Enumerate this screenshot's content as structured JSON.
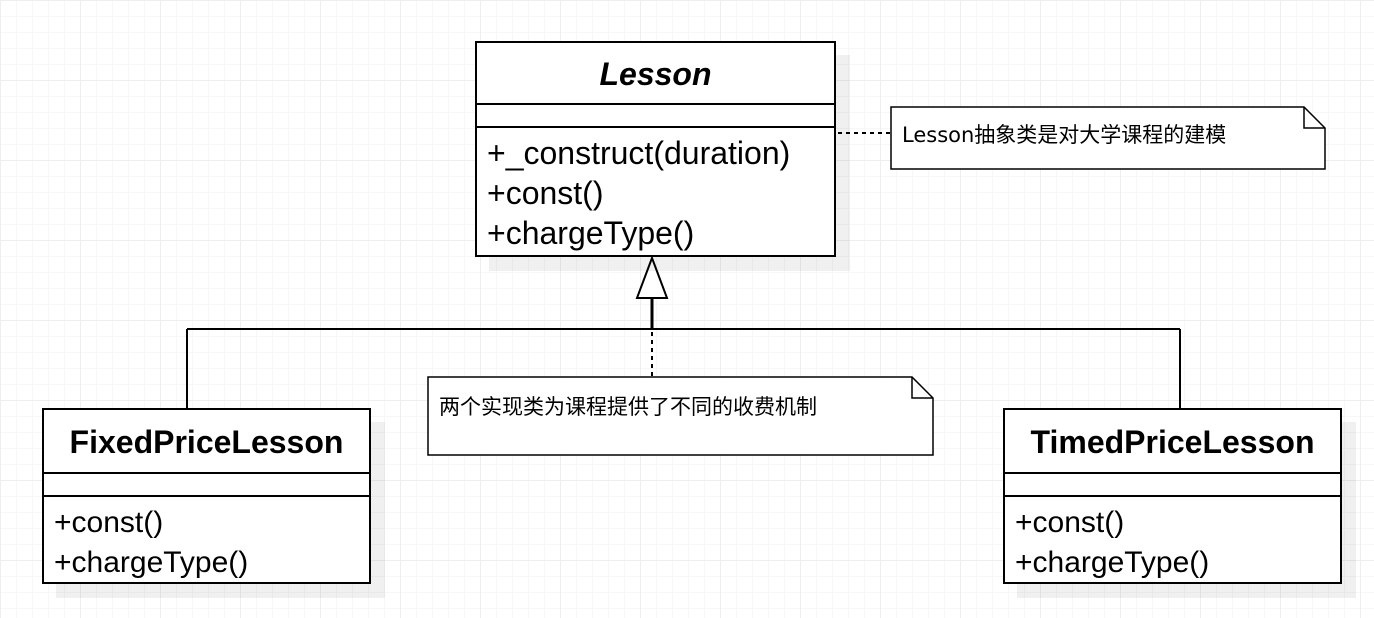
{
  "diagram": {
    "classes": {
      "lesson": {
        "name": "Lesson",
        "attributes": [],
        "methods": [
          "+_construct(duration)",
          "+const()",
          "+chargeType()"
        ]
      },
      "fixed": {
        "name": "FixedPriceLesson",
        "attributes": [],
        "methods": [
          "+const()",
          "+chargeType()"
        ]
      },
      "timed": {
        "name": "TimedPriceLesson",
        "attributes": [],
        "methods": [
          "+const()",
          "+chargeType()"
        ]
      }
    },
    "notes": {
      "lesson": "Lesson抽象类是对大学课程的建模",
      "impl": "两个实现类为课程提供了不同的收费机制"
    },
    "relationships": [
      {
        "type": "generalization",
        "from": "FixedPriceLesson",
        "to": "Lesson"
      },
      {
        "type": "generalization",
        "from": "TimedPriceLesson",
        "to": "Lesson"
      }
    ]
  }
}
